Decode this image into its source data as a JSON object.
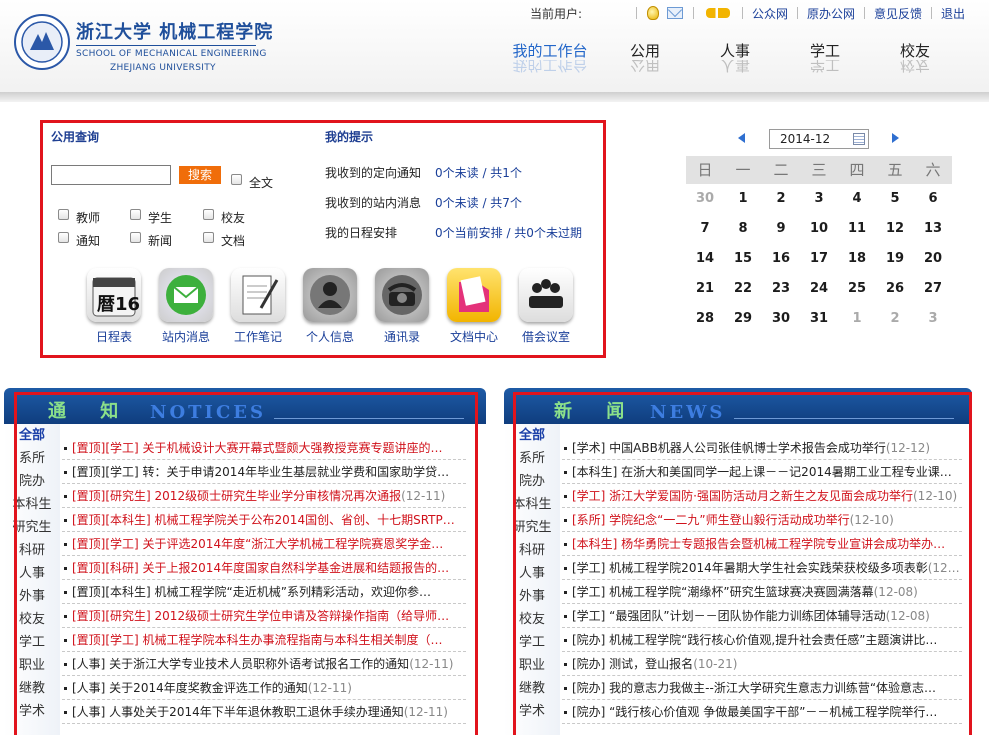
{
  "header": {
    "school_cn": "浙江大学 机械工程学院",
    "school_en1": "SCHOOL OF MECHANICAL ENGINEERING",
    "school_en2": "ZHEJIANG UNIVERSITY",
    "current_user_label": "当前用户:",
    "links": [
      "公众网",
      "原办公网",
      "意见反馈",
      "退出"
    ],
    "nav": [
      "我的工作台",
      "公用",
      "人事",
      "学工",
      "校友"
    ]
  },
  "query": {
    "title": "公用查询",
    "search_btn": "搜索",
    "all_label": "全文",
    "checkboxes": [
      "教师",
      "学生",
      "校友",
      "通知",
      "新闻",
      "文档"
    ]
  },
  "tips": {
    "title": "我的提示",
    "rows": [
      {
        "label": "我收到的定向通知",
        "value": "0个未读 / 共1个"
      },
      {
        "label": "我收到的站内消息",
        "value": "0个未读 / 共7个"
      },
      {
        "label": "我的日程安排",
        "value": "0个当前安排 / 共0个未过期"
      }
    ]
  },
  "apps": [
    "日程表",
    "站内消息",
    "工作笔记",
    "个人信息",
    "通讯录",
    "文档中心",
    "借会议室"
  ],
  "calendar": {
    "month": "2014-12",
    "dow": [
      "日",
      "一",
      "二",
      "三",
      "四",
      "五",
      "六"
    ],
    "weeks": [
      [
        "30",
        "1",
        "2",
        "3",
        "4",
        "5",
        "6"
      ],
      [
        "7",
        "8",
        "9",
        "10",
        "11",
        "12",
        "13"
      ],
      [
        "14",
        "15",
        "16",
        "17",
        "18",
        "19",
        "20"
      ],
      [
        "21",
        "22",
        "23",
        "24",
        "25",
        "26",
        "27"
      ],
      [
        "28",
        "29",
        "30",
        "31",
        "1",
        "2",
        "3"
      ]
    ]
  },
  "notices": {
    "title_cn": "通 知",
    "title_en": "NOTICES",
    "categories": [
      "全部",
      "系所",
      "院办",
      "本科生",
      "研究生",
      "科研",
      "人事",
      "外事",
      "校友",
      "学工",
      "职业",
      "继教",
      "学术"
    ],
    "items": [
      {
        "text": "[置顶][学工] 关于机械设计大赛开幕式暨颇大强教授竞赛专题讲座的…",
        "red": true
      },
      {
        "text": "[置顶][学工] 转：关于申请2014年毕业生基层就业学费和国家助学贷…",
        "red": false
      },
      {
        "text": "[置顶][研究生] 2012级硕士研究生毕业学分审核情况再次通报",
        "date": "(12-11)",
        "red": true
      },
      {
        "text": "[置顶][本科生] 机械工程学院关于公布2014国创、省创、十七期SRTP…",
        "red": true
      },
      {
        "text": "[置顶][学工] 关于评选2014年度“浙江大学机械工程学院赛恩奖学金…",
        "red": true
      },
      {
        "text": "[置顶][科研] 关于上报2014年度国家自然科学基金进展和结题报告的…",
        "red": true
      },
      {
        "text": "[置顶][本科生] 机械工程学院“走近机械”系列精彩活动，欢迎你参…",
        "red": false
      },
      {
        "text": "[置顶][研究生] 2012级硕士研究生学位申请及答辩操作指南（给导师…",
        "red": true
      },
      {
        "text": "[置顶][学工] 机械工程学院本科生办事流程指南与本科生相关制度（…",
        "red": true
      },
      {
        "text": "[人事] 关于浙江大学专业技术人员职称外语考试报名工作的通知",
        "date": "(12-11)",
        "red": false
      },
      {
        "text": "[人事] 关于2014年度奖教金评选工作的通知",
        "date": "(12-11)",
        "red": false
      },
      {
        "text": "[人事] 人事处关于2014年下半年退休教职工退休手续办理通知",
        "date": "(12-11)",
        "red": false
      }
    ]
  },
  "news": {
    "title_cn": "新 闻",
    "title_en": "NEWS",
    "categories": [
      "全部",
      "系所",
      "院办",
      "本科生",
      "研究生",
      "科研",
      "人事",
      "外事",
      "校友",
      "学工",
      "职业",
      "继教",
      "学术"
    ],
    "items": [
      {
        "text": "[学术] 中国ABB机器人公司张佳帆博士学术报告会成功举行",
        "date": "(12-12)",
        "red": false
      },
      {
        "text": "[本科生] 在浙大和美国同学一起上课－－记2014暑期工业工程专业课…",
        "red": false
      },
      {
        "text": "[学工] 浙江大学爱国防·强国防活动月之新生之友见面会成功举行",
        "date": "(12-10)",
        "red": true
      },
      {
        "text": "[系所] 学院纪念“一二九”师生登山毅行活动成功举行",
        "date": "(12-10)",
        "red": true
      },
      {
        "text": "[本科生] 杨华勇院士专题报告会暨机械工程学院专业宣讲会成功举办…",
        "red": true
      },
      {
        "text": "[学工] 机械工程学院2014年暑期大学生社会实践荣获校级多项表彰",
        "date": "(12…",
        "red": false
      },
      {
        "text": "[学工] 机械工程学院“潮缘杯”研究生篮球赛决赛圆满落幕",
        "date": "(12-08)",
        "red": false
      },
      {
        "text": "[学工] “最强团队”计划－－团队协作能力训练团体辅导活动",
        "date": "(12-08)",
        "red": false
      },
      {
        "text": "[院办] 机械工程学院“践行核心价值观,提升社会责任感”主题演讲比…",
        "red": false
      },
      {
        "text": "[院办] 测试，登山报名",
        "date": "(10-21)",
        "red": false
      },
      {
        "text": "[院办] 我的意志力我做主--浙江大学研究生意志力训练营“体验意志…",
        "red": false
      },
      {
        "text": "[院办] “践行核心价值观 争做最美国字干部”－－机械工程学院举行…",
        "red": false
      }
    ]
  }
}
